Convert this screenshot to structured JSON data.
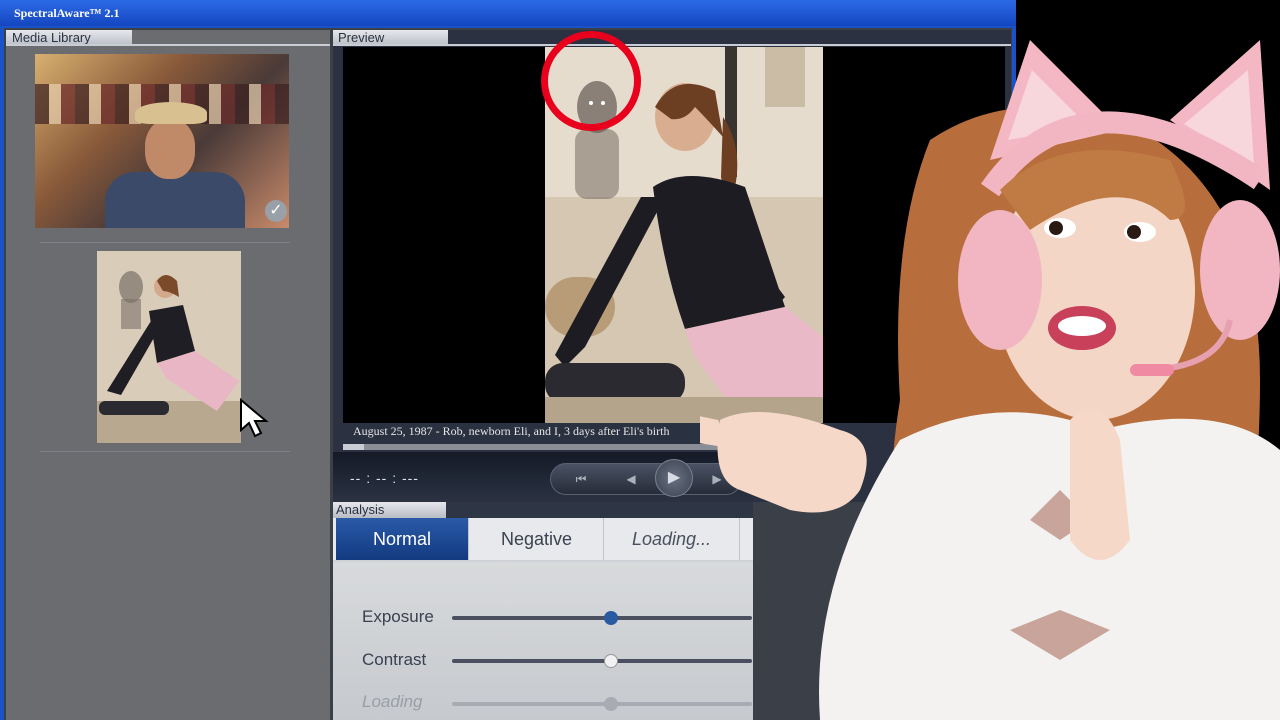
{
  "app": {
    "title": "SpectralAware™ 2.1"
  },
  "library": {
    "header": "Media Library",
    "thumbnails": [
      {
        "name": "family-photo",
        "checked": true
      },
      {
        "name": "pilates-photo",
        "checked": false
      }
    ]
  },
  "preview": {
    "header": "Preview",
    "caption": "August 25, 1987 - Rob, newborn Eli, and I, 3 days after Eli's birth",
    "timecode": "-- : -- : ---",
    "progress_fraction": 0.04
  },
  "analysis": {
    "header": "Analysis",
    "tabs": [
      {
        "label": "Normal",
        "active": true
      },
      {
        "label": "Negative",
        "active": false
      },
      {
        "label": "Loading...",
        "active": false
      }
    ],
    "sliders": [
      {
        "label": "Exposure",
        "value": 0.53,
        "enabled": true
      },
      {
        "label": "Contrast",
        "value": 0.53,
        "enabled": true
      },
      {
        "label": "Loading",
        "value": 0.53,
        "enabled": false
      }
    ]
  },
  "colors": {
    "title_bar": "#1a52c8",
    "active_tab": "#1e4a94",
    "highlight_ring": "#e8001c",
    "knob_active": "#2a5aa0"
  }
}
